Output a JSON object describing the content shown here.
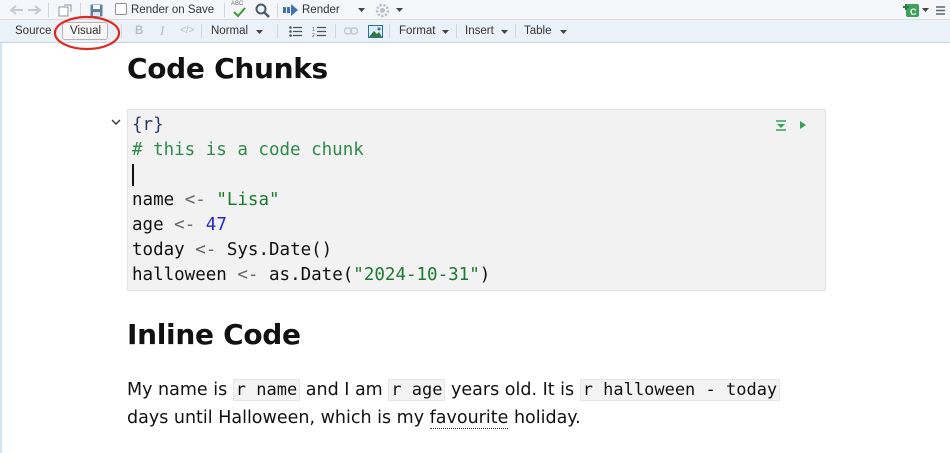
{
  "toolbar_top": {
    "render_on_save_label": "Render on Save",
    "render_label": "Render",
    "spell_icon_text": "ABC"
  },
  "toolbar_editor": {
    "source_tab": "Source",
    "visual_tab": "Visual",
    "bold": "B",
    "italic": "I",
    "code": "</>",
    "style_select": "Normal",
    "format_menu": "Format",
    "insert_menu": "Insert",
    "table_menu": "Table"
  },
  "colors": {
    "annotation_circle": "#e0281d",
    "code_bg": "#f2f2f2",
    "comment": "#2f8a4a",
    "string": "#1c7a2e",
    "number": "#2129c9",
    "run_button": "#3aa05a"
  },
  "doc": {
    "heading1": "Code Chunks",
    "chunk_header": "{r}",
    "chunk_comment": "# this is a code chunk",
    "line_name_var": "name",
    "line_name_str": "\"Lisa\"",
    "line_age_var": "age",
    "line_age_num": "47",
    "line_today_var": "today",
    "line_today_call": "Sys.Date()",
    "line_hw_var": "halloween",
    "line_hw_fn": "as.Date(",
    "line_hw_str": "\"2024-10-31\"",
    "line_hw_close": ")",
    "assign_op": "<-",
    "heading2": "Inline Code",
    "p_part1": "My name is ",
    "inline_name": "r name",
    "p_part2": " and I am ",
    "inline_age": "r age",
    "p_part3": " years old. It is ",
    "inline_halloween": "r halloween - today",
    "p_line2_a": "days until Halloween, which is my ",
    "p_line2_word": "favourite",
    "p_line2_b": " holiday."
  }
}
